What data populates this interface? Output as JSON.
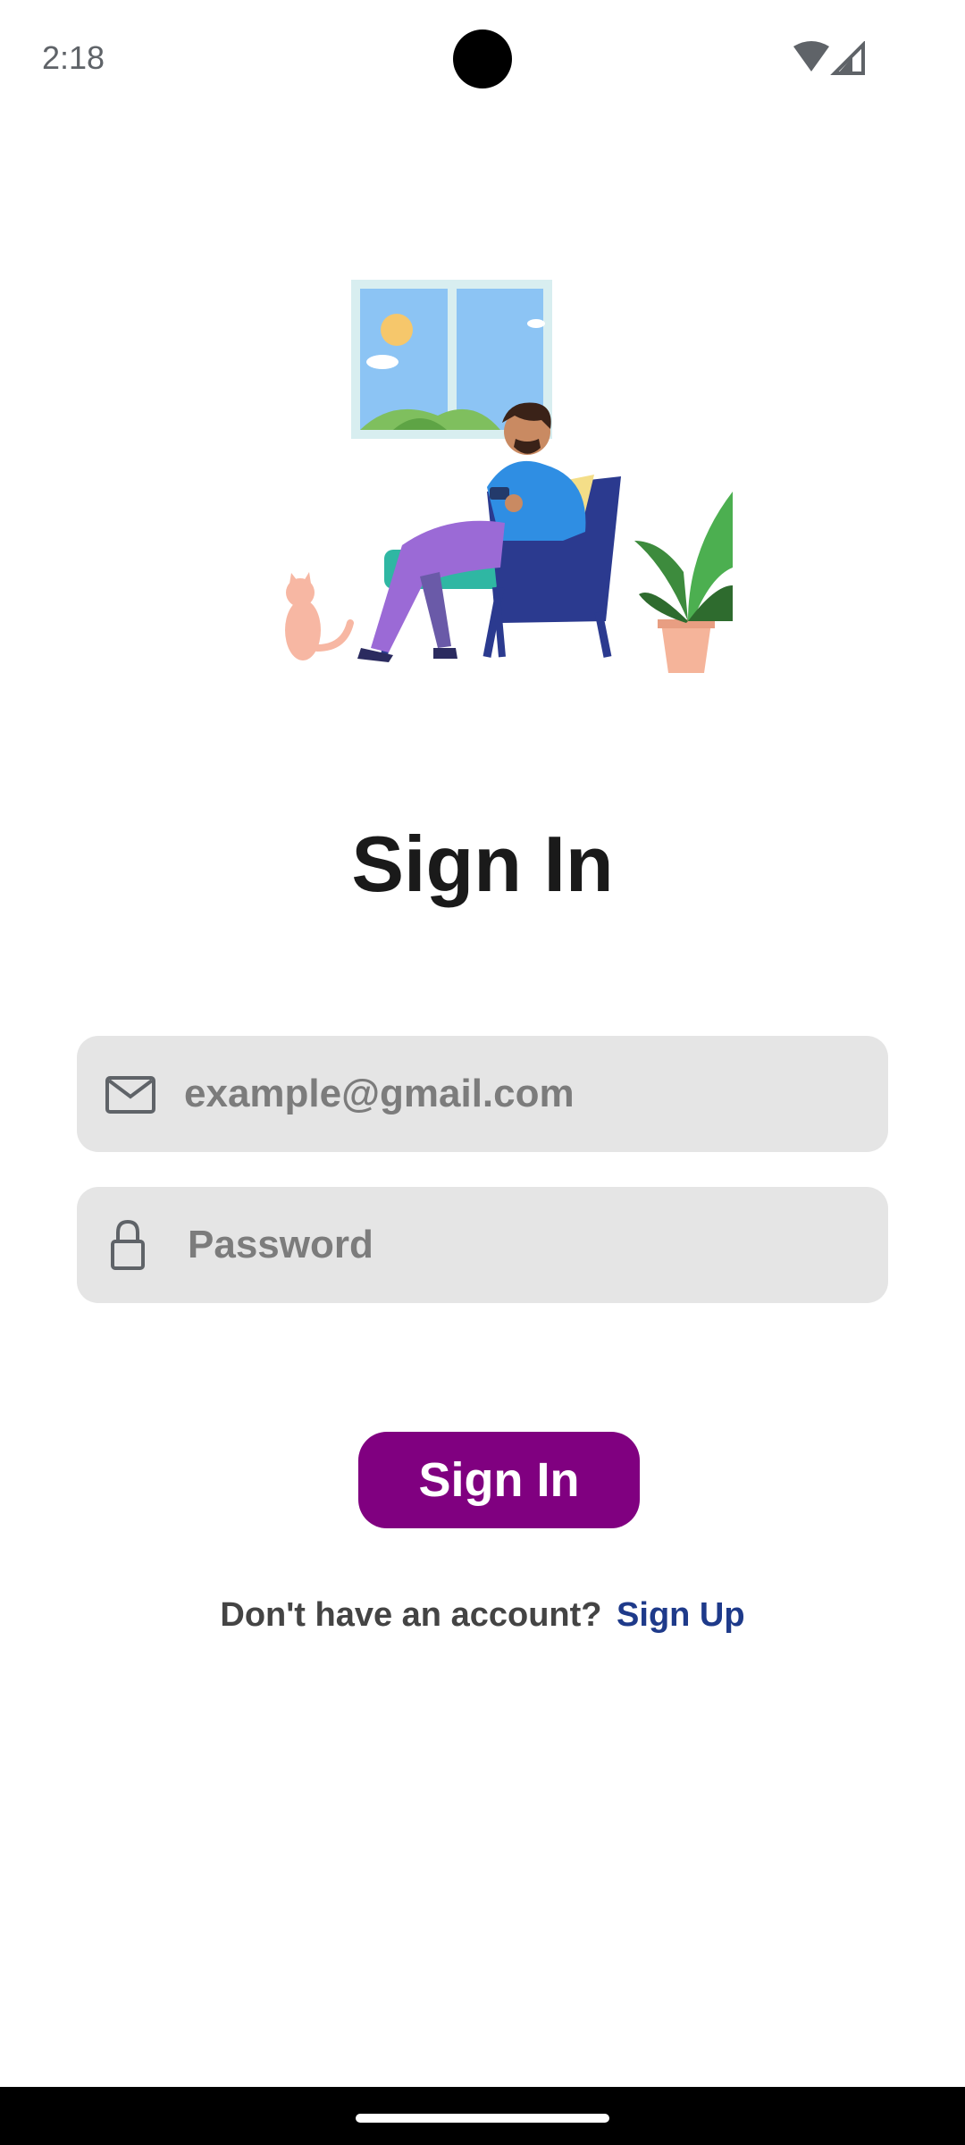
{
  "status_bar": {
    "time": "2:18",
    "icons": [
      "wifi-icon",
      "cell-signal-icon"
    ]
  },
  "illustration": {
    "name": "man-on-armchair-illustration"
  },
  "page": {
    "title": "Sign In"
  },
  "form": {
    "email": {
      "icon": "mail-icon",
      "value": "",
      "placeholder": "example@gmail.com"
    },
    "password": {
      "icon": "lock-icon",
      "value": "",
      "placeholder": "Password"
    },
    "submit_label": "Sign In"
  },
  "footer": {
    "prompt": "Don't have an account?",
    "link_label": "Sign Up"
  },
  "colors": {
    "primary": "#800080",
    "link": "#1e3a8a",
    "field_bg": "#e5e5e5"
  }
}
